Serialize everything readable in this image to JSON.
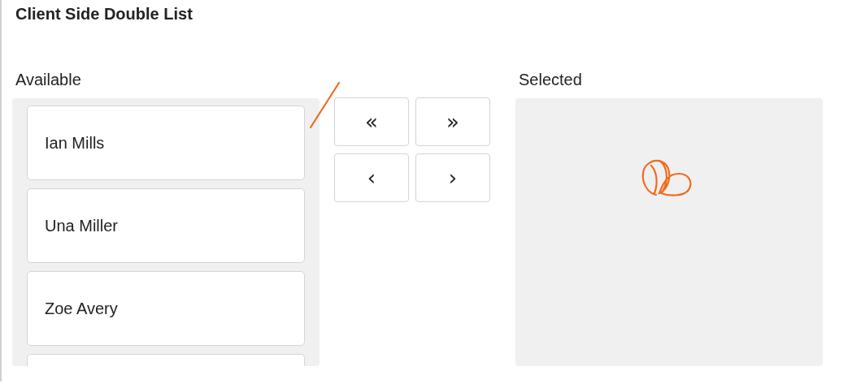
{
  "title": "Client Side Double List",
  "available": {
    "label": "Available",
    "items": [
      {
        "name": "Ian Mills"
      },
      {
        "name": "Una Miller"
      },
      {
        "name": "Zoe Avery"
      }
    ]
  },
  "buttons": [
    {
      "label": "«"
    },
    {
      "label": "»"
    },
    {
      "label": "‹"
    },
    {
      "label": "›"
    }
  ],
  "selected": {
    "label": "Selected"
  }
}
